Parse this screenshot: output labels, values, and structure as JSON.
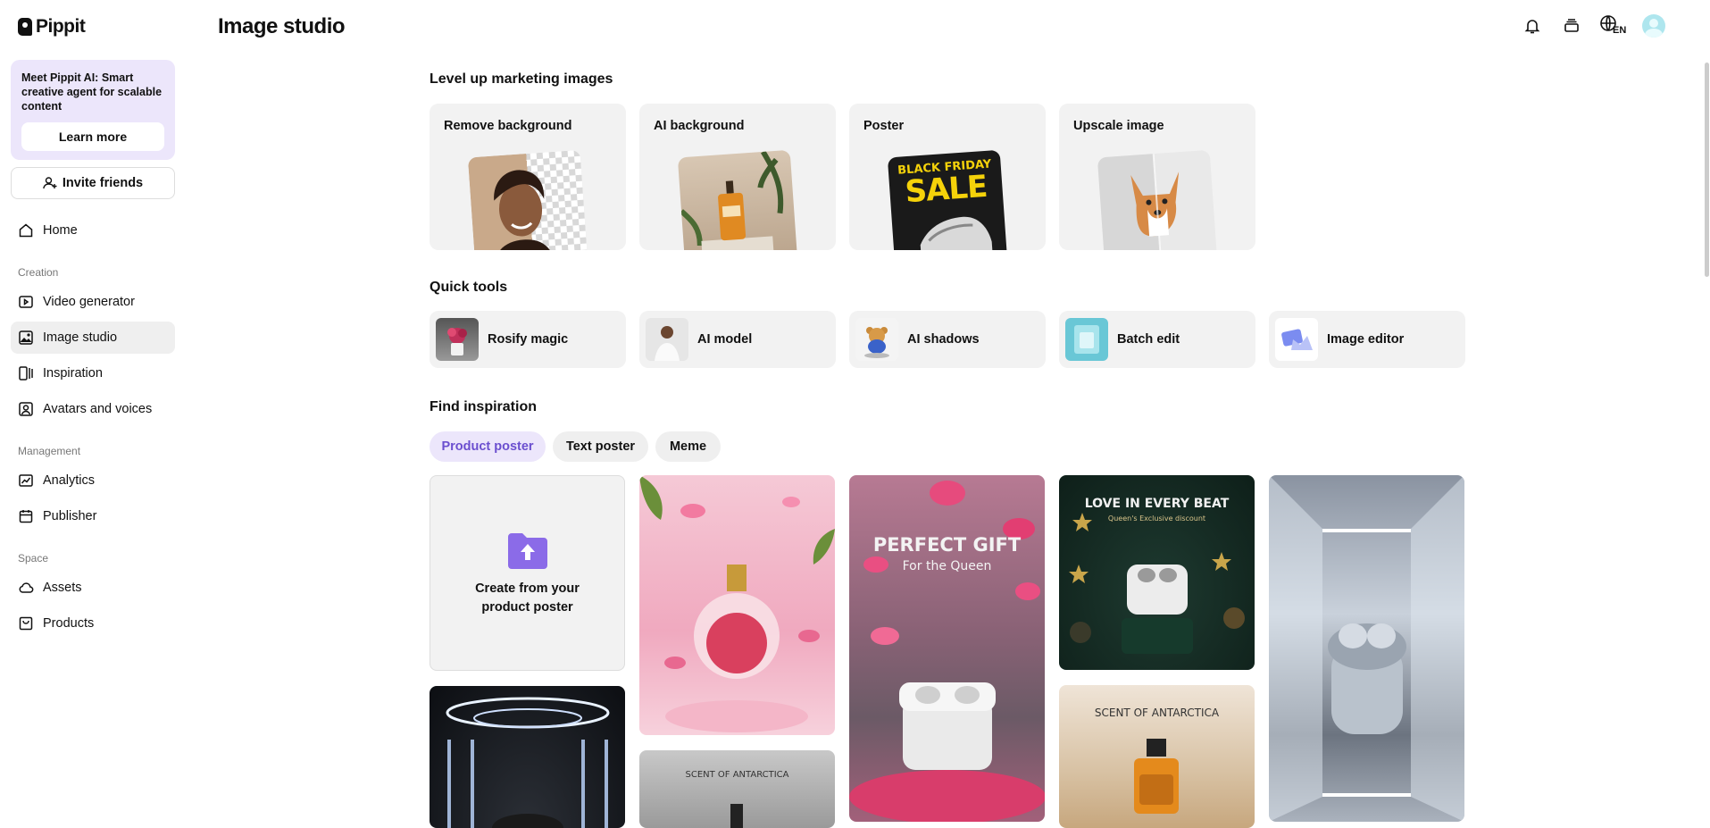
{
  "app": {
    "brand": "Pippit"
  },
  "sidebar": {
    "promo": {
      "text": "Meet Pippit AI: Smart creative agent for scalable content",
      "button": "Learn more"
    },
    "invite_label": "Invite friends",
    "home": "Home",
    "sections": {
      "creation": "Creation",
      "management": "Management",
      "space": "Space"
    },
    "items": {
      "video_generator": "Video generator",
      "image_studio": "Image studio",
      "inspiration": "Inspiration",
      "avatars": "Avatars and voices",
      "analytics": "Analytics",
      "publisher": "Publisher",
      "assets": "Assets",
      "products": "Products"
    }
  },
  "header": {
    "title": "Image studio",
    "lang": "EN"
  },
  "marketing": {
    "title": "Level up marketing images",
    "cards": [
      "Remove background",
      "AI background",
      "Poster",
      "Upscale image"
    ],
    "poster_art": {
      "line1": "BLACK FRIDAY",
      "line2": "SALE"
    }
  },
  "quick_tools": {
    "title": "Quick tools",
    "items": [
      "Rosify magic",
      "AI model",
      "AI shadows",
      "Batch edit",
      "Image editor"
    ]
  },
  "inspiration": {
    "title": "Find inspiration",
    "tabs": [
      "Product poster",
      "Text poster",
      "Meme"
    ],
    "create_tile": "Create from your product poster",
    "posters": {
      "gift_title": "PERFECT GIFT",
      "gift_sub": "For the Queen",
      "love_title": "LOVE IN EVERY BEAT",
      "love_sub": "Queen's Exclusive discount",
      "scent_1": "SCENT OF ANTARCTICA",
      "scent_2": "SCENT OF ANTARCTICA"
    }
  },
  "colors": {
    "accent": "#6b4fcf",
    "promo_bg": "#ece6fb",
    "card_bg": "#f2f2f2"
  }
}
